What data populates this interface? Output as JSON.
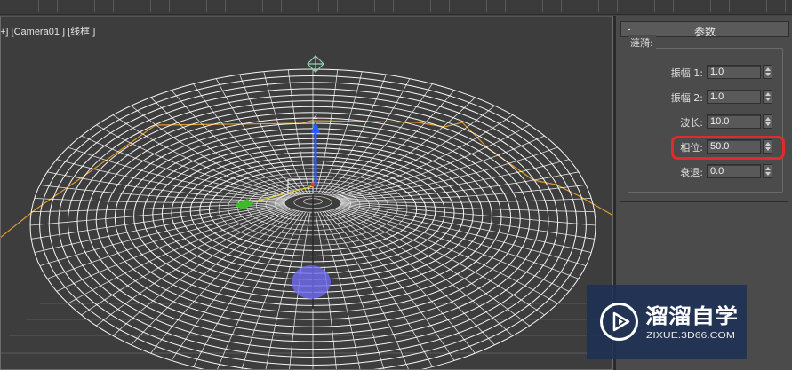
{
  "viewport": {
    "label": "+] [Camera01 ] [线框 ]"
  },
  "rollout": {
    "collapse_sign": "-",
    "title": "参数"
  },
  "group": {
    "title": "涟漪:"
  },
  "params": [
    {
      "label": "振幅 1:",
      "value": "1.0"
    },
    {
      "label": "振幅 2:",
      "value": "1.0"
    },
    {
      "label": "波长:",
      "value": "10.0"
    },
    {
      "label": "相位:",
      "value": "50.0"
    },
    {
      "label": "衰退:",
      "value": "0.0"
    }
  ],
  "gizmo_axis_label": "Z",
  "watermark": {
    "brand": "溜溜自学",
    "url": "ZIXUE.3D66.COM"
  },
  "colors": {
    "viewport_bg": "#3d3d3d",
    "panel_bg": "#4b4b4b",
    "wireframe": "#ffffff",
    "gizmo_orange": "#e09a2a",
    "highlight_red": "#e32a2a",
    "axis_blue": "#2a5cff",
    "axis_green": "#3dbb2b",
    "camera_icon": "#8dd6b4",
    "selection_sphere": "#6f6cf2"
  },
  "icons": [
    "camera-target-icon",
    "play-logo-icon"
  ]
}
